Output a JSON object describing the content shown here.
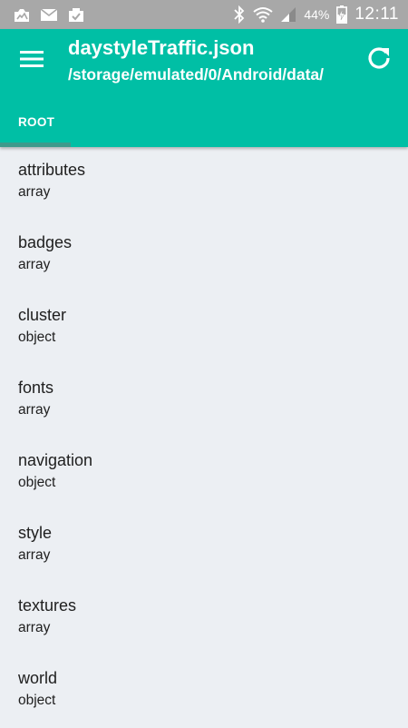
{
  "status_bar": {
    "battery_percent": "44%",
    "time": "12:11",
    "icons": [
      "photo-notification-icon",
      "mail-icon",
      "clipboard-check-icon",
      "bluetooth-icon",
      "wifi-icon",
      "signal-icon",
      "battery-charging-icon"
    ]
  },
  "app_bar": {
    "title": "daystyleTraffic.json",
    "subtitle": "/storage/emulated/0/Android/data/",
    "menu_icon": "hamburger-menu-icon",
    "refresh_icon": "refresh-icon",
    "tabs": [
      {
        "label": "ROOT",
        "selected": true
      }
    ],
    "colors": {
      "primary": "#00bfa5",
      "tab_indicator": "#3e9a8c"
    }
  },
  "items": [
    {
      "name": "attributes",
      "type": "array"
    },
    {
      "name": "badges",
      "type": "array"
    },
    {
      "name": "cluster",
      "type": "object"
    },
    {
      "name": "fonts",
      "type": "array"
    },
    {
      "name": "navigation",
      "type": "object"
    },
    {
      "name": "style",
      "type": "array"
    },
    {
      "name": "textures",
      "type": "array"
    },
    {
      "name": "world",
      "type": "object"
    }
  ]
}
